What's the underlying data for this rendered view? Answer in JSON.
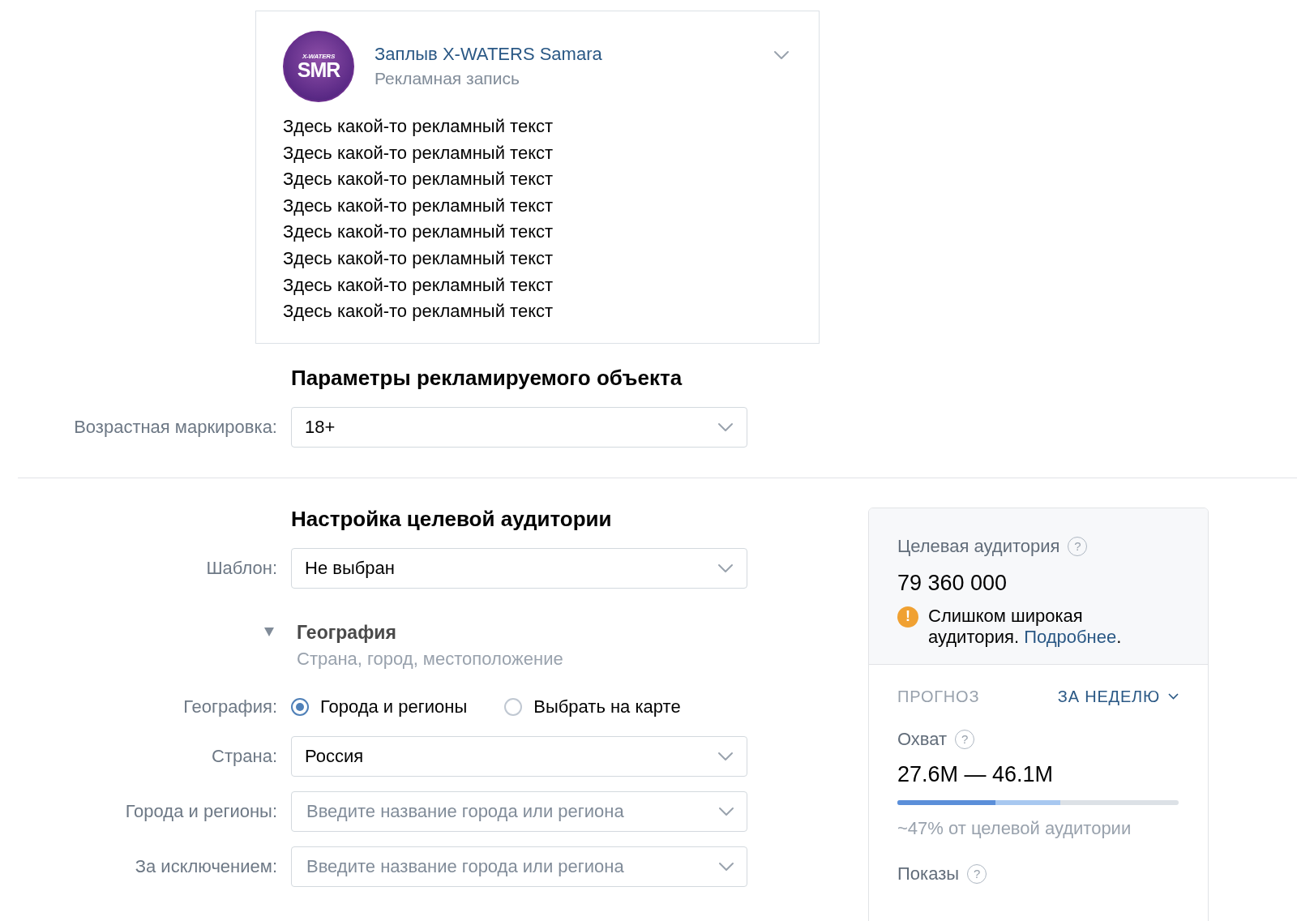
{
  "ad_post": {
    "logo": {
      "top": "X-WATERS",
      "main": "SMR"
    },
    "name": "Заплыв X-WATERS Samara",
    "subtitle": "Рекламная запись",
    "lines": [
      "Здесь какой-то рекламный текст",
      "Здесь какой-то рекламный текст",
      "Здесь какой-то рекламный текст",
      "Здесь какой-то рекламный текст",
      "Здесь какой-то рекламный текст",
      "Здесь какой-то рекламный текст",
      "Здесь какой-то рекламный текст",
      "Здесь какой-то рекламный текст"
    ]
  },
  "object_params": {
    "heading": "Параметры рекламируемого объекта",
    "fields": [
      {
        "kind": "select",
        "label": "Возрастная маркировка:",
        "value": "18+"
      }
    ]
  },
  "audience": {
    "heading": "Настройка целевой аудитории",
    "fields": [
      {
        "kind": "select",
        "label": "Шаблон:",
        "value": "Не выбран"
      }
    ],
    "geography": {
      "expanded": true,
      "title": "География",
      "subtitle": "Страна, город, местоположение",
      "fields": [
        {
          "kind": "radio",
          "label": "География:",
          "options": [
            {
              "label": "Города и регионы",
              "selected": true
            },
            {
              "label": "Выбрать на карте",
              "selected": false
            }
          ]
        },
        {
          "kind": "select",
          "label": "Страна:",
          "value": "Россия"
        },
        {
          "kind": "select",
          "label": "Города и регионы:",
          "placeholder": "Введите название города или региона"
        },
        {
          "kind": "select",
          "label": "За исключением:",
          "placeholder": "Введите название города или региона"
        }
      ]
    }
  },
  "summary_panel": {
    "title": "Целевая аудитория",
    "help": "?",
    "audience_size": "79 360 000",
    "warning": {
      "icon": "!",
      "text": "Слишком широкая аудитория.",
      "link": "Подробнее",
      "end": "."
    },
    "forecast_label": "ПРОГНОЗ",
    "period": "ЗА НЕДЕЛЮ",
    "reach": {
      "title": "Охват",
      "help": "?",
      "range": "27.6M — 46.1M",
      "segments": [
        {
          "kind": "max",
          "level": 0.58
        },
        {
          "kind": "min",
          "level": 0.35
        }
      ],
      "note": "~47% от целевой аудитории"
    },
    "impressions": {
      "title": "Показы",
      "help": "?"
    }
  }
}
